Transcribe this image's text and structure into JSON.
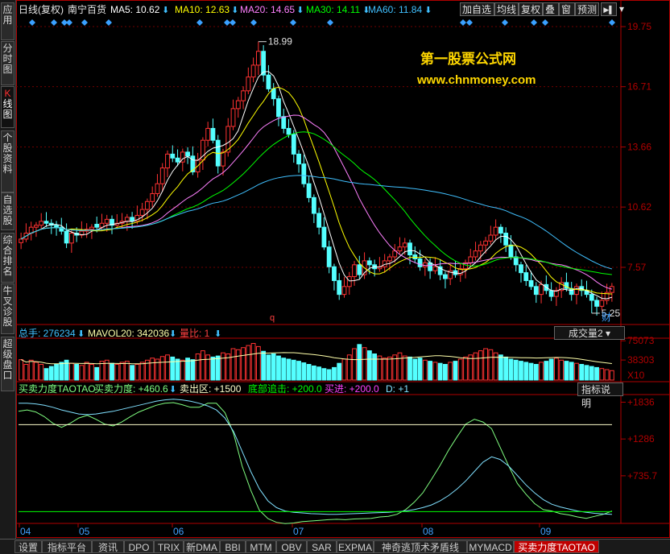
{
  "left_tabs": [
    {
      "label": "应用",
      "active": false
    },
    {
      "label": "分时图",
      "active": false
    },
    {
      "label": "K线图",
      "active": true
    },
    {
      "label": "个股资料",
      "active": false
    },
    {
      "label": "自选股",
      "active": false
    },
    {
      "label": "综合排名",
      "active": false
    },
    {
      "label": "牛叉诊股",
      "active": false
    },
    {
      "label": "超级盘口",
      "active": false
    }
  ],
  "toolbar": {
    "buttons": [
      "加自选",
      "均线",
      "复权",
      "叠",
      "窗",
      "预测"
    ],
    "nav_icon": "arrow-left-icon",
    "menu_icon": "dropdown-arrow-icon"
  },
  "header": {
    "period": "日线(复权)",
    "stock_name": "南宁百货",
    "ma": [
      {
        "label": "MA5: 10.62",
        "color": "#ffffff"
      },
      {
        "label": "MA10: 12.63",
        "color": "#ffff00"
      },
      {
        "label": "MA20: 14.65",
        "color": "#ff80ff"
      },
      {
        "label": "MA30: 14.11",
        "color": "#00ff00"
      },
      {
        "label": "MA60: 11.84",
        "color": "#40c0ff"
      }
    ]
  },
  "watermark": {
    "line1": "第一股票公式网",
    "line2": "www.chnmoney.com"
  },
  "volume_header": {
    "total": "总手: 276234",
    "mavol": "MAVOL20: 342036",
    "ratio": "量比: 1"
  },
  "volume_selector": "成交量2",
  "indicator_header": {
    "name": "买卖力度TAOTAO",
    "force": "买卖力度: +460.6",
    "sell_zone": "卖出区: +1500",
    "bottom": "底部追击: +200.0",
    "buy": "买进: +200.0",
    "d": "D: +1"
  },
  "indicator_button": "指标说明",
  "colors": {
    "up": "#ff3232",
    "down": "#54ffff",
    "axis": "#b00000"
  },
  "chart_data": [
    {
      "type": "candlestick",
      "title": "",
      "ylim": [
        4.8,
        20.2
      ],
      "yticks": [
        19.75,
        16.71,
        13.66,
        10.62,
        7.57
      ],
      "xticks": [
        "04",
        "05",
        "06",
        "07",
        "08",
        "09"
      ],
      "annotations": [
        {
          "text": "18.99",
          "value": 18.99
        },
        {
          "text": "5.25",
          "value": 5.25
        },
        {
          "text": "q"
        },
        {
          "text": "财"
        }
      ],
      "closes": [
        9.0,
        9.3,
        9.6,
        9.7,
        9.9,
        9.8,
        9.7,
        9.6,
        9.4,
        8.8,
        9.3,
        9.2,
        9.4,
        9.5,
        9.6,
        9.6,
        9.8,
        10.0,
        9.7,
        9.8,
        9.9,
        10.1,
        9.9,
        10.2,
        10.5,
        10.9,
        11.3,
        11.8,
        12.6,
        13.3,
        13.1,
        12.9,
        13.4,
        13.2,
        12.4,
        13.0,
        14.0,
        14.6,
        14.0,
        12.7,
        13.4,
        14.7,
        15.6,
        16.0,
        16.5,
        17.2,
        17.8,
        18.5,
        17.3,
        16.6,
        16.1,
        15.2,
        14.6,
        14.3,
        13.3,
        12.8,
        11.8,
        11.1,
        10.3,
        9.6,
        8.6,
        7.6,
        6.9,
        6.2,
        6.6,
        7.1,
        7.7,
        7.2,
        7.9,
        7.7,
        7.5,
        7.6,
        7.9,
        8.1,
        8.4,
        8.6,
        8.8,
        8.2,
        8.0,
        7.6,
        7.8,
        7.4,
        7.6,
        7.2,
        7.0,
        7.4,
        7.2,
        7.5,
        7.8,
        8.1,
        8.4,
        8.7,
        8.9,
        9.2,
        9.6,
        9.3,
        8.7,
        8.1,
        7.7,
        7.3,
        6.9,
        6.6,
        6.2,
        6.7,
        6.4,
        6.1,
        6.4,
        6.8,
        6.5,
        6.2,
        6.6,
        6.4,
        6.2,
        5.9,
        5.6,
        5.9,
        6.3,
        6.6
      ],
      "series": [
        {
          "name": "MA5",
          "color": "#ffffff"
        },
        {
          "name": "MA10",
          "color": "#ffff00"
        },
        {
          "name": "MA20",
          "color": "#ff80ff"
        },
        {
          "name": "MA30",
          "color": "#00ff00"
        },
        {
          "name": "MA60",
          "color": "#40c0ff"
        }
      ]
    },
    {
      "type": "bar",
      "title": "",
      "ylim": [
        0,
        80000
      ],
      "yticks": [
        75073,
        38303
      ],
      "multiplier": "X10",
      "values": [
        39000,
        30000,
        38000,
        34000,
        30000,
        22000,
        26000,
        30000,
        34000,
        38000,
        32000,
        30000,
        28000,
        34000,
        30000,
        24000,
        36000,
        38000,
        32000,
        30000,
        34000,
        36000,
        28000,
        30000,
        34000,
        38000,
        42000,
        40000,
        45000,
        48000,
        44000,
        40000,
        38000,
        42000,
        39000,
        50000,
        56000,
        48000,
        44000,
        46000,
        52000,
        50000,
        60000,
        58000,
        62000,
        66000,
        70000,
        64000,
        55000,
        48000,
        50000,
        46000,
        42000,
        40000,
        38000,
        36000,
        33000,
        30000,
        27000,
        25000,
        22000,
        20000,
        24000,
        32000,
        40000,
        48000,
        60000,
        68000,
        62000,
        56000,
        50000,
        46000,
        42000,
        44000,
        48000,
        52000,
        46000,
        44000,
        40000,
        42000,
        38000,
        36000,
        34000,
        32000,
        30000,
        34000,
        36000,
        40000,
        44000,
        48000,
        52000,
        56000,
        60000,
        58000,
        52000,
        48000,
        44000,
        40000,
        38000,
        36000,
        34000,
        32000,
        30000,
        34000,
        36000,
        40000,
        42000,
        38000,
        36000,
        34000,
        32000,
        30000,
        28000,
        26000,
        24000,
        22000,
        20000,
        18000
      ],
      "ma_line_color": "#ffffaa"
    },
    {
      "type": "line",
      "title": "",
      "ylim": [
        0,
        1950
      ],
      "yticks": [
        1836,
        1286,
        735.7
      ],
      "series": [
        {
          "name": "买卖力度",
          "color": "#80ff80",
          "values": [
            1700,
            1720,
            1690,
            1620,
            1520,
            1460,
            1520,
            1600,
            1640,
            1580,
            1510,
            1480,
            1540,
            1620,
            1690,
            1740,
            1790,
            1820,
            1830,
            1800,
            1760,
            1760,
            1820,
            1820,
            1680,
            1370,
            880,
            520,
            220,
            95,
            40,
            20,
            30,
            50,
            60,
            70,
            80,
            85,
            80,
            90,
            95,
            100,
            120,
            130,
            160,
            230,
            340,
            480,
            680,
            890,
            1120,
            1320,
            1510,
            1580,
            1540,
            1440,
            1160,
            880,
            620,
            460,
            320,
            230,
            210,
            170,
            150,
            120,
            100,
            130,
            160,
            210
          ]
        },
        {
          "name": "D",
          "color": "#80e0ff",
          "values": [
            1820,
            1820,
            1810,
            1790,
            1760,
            1720,
            1690,
            1660,
            1650,
            1660,
            1680,
            1700,
            1730,
            1760,
            1790,
            1820,
            1850,
            1870,
            1880,
            1870,
            1850,
            1820,
            1780,
            1720,
            1600,
            1400,
            1100,
            800,
            540,
            360,
            260,
            210,
            190,
            180,
            170,
            165,
            160,
            160,
            165,
            170,
            175,
            180,
            185,
            190,
            200,
            210,
            230,
            260,
            300,
            360,
            440,
            540,
            660,
            800,
            940,
            1020,
            980,
            880,
            740,
            600,
            480,
            380,
            310,
            270,
            240,
            210,
            190,
            175,
            165,
            160
          ]
        },
        {
          "name": "卖出区",
          "color": "#ffffcc",
          "values": [
            1500
          ]
        },
        {
          "name": "底部追击",
          "color": "#00ff00",
          "values": [
            200
          ]
        }
      ]
    }
  ],
  "bottom_tabs": [
    "设置",
    "指标平台",
    "资讯",
    "DPO",
    "TRIX",
    "新DMA",
    "BBI",
    "MTM",
    "OBV",
    "SAR",
    "EXPMA",
    "神奇逃顶术矛盾线",
    "MYMACD",
    "买卖力度TAOTAO"
  ],
  "bottom_active": 13
}
